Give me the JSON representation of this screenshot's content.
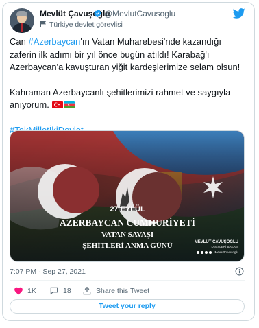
{
  "header": {
    "name": "Mevlüt Çavuşoğlu",
    "handle": "@MevlutCavusoglu",
    "label": "Türkiye devlet görevlisi"
  },
  "tweet": {
    "p1_a": "Can ",
    "p1_hashtag": "#Azerbaycan",
    "p1_b": "'ın Vatan Muharebesi'nde kazandığı zaferin ilk adımı bir yıl önce bugün atıldı! Karabağ'ı Azerbaycan'a kavuşturan yiğit kardeşlerimize selam olsun!",
    "p2": "Kahraman Azerbaycanlı şehitlerimizi rahmet ve saygıyla anıyorum.",
    "p3_hashtag": "#TekMilletİkiDevlet"
  },
  "media": {
    "date_text": "27 EYLÜL",
    "line1": "AZERBAYCAN CUMHURİYETİ",
    "line2": "VATAN SAVAŞI",
    "line3": "ŞEHİTLERİ ANMA GÜNÜ",
    "sign_name": "MEVLÜT ÇAVUŞOĞLU",
    "sign_title": "DIŞİŞLERİ BAKANI",
    "sign_handle": "MevlutCavusoglu"
  },
  "meta": {
    "timestamp": "7:07 PM · Sep 27, 2021"
  },
  "actions": {
    "likes": "1K",
    "replies": "18",
    "share": "Share this Tweet"
  },
  "reply_button": "Tweet your reply",
  "colors": {
    "accent": "#1d9bf0",
    "like": "#f91880",
    "az_blue": "#00b5e2",
    "az_red": "#ef3340",
    "az_green": "#509e2f",
    "tr_red": "#e30a17"
  }
}
